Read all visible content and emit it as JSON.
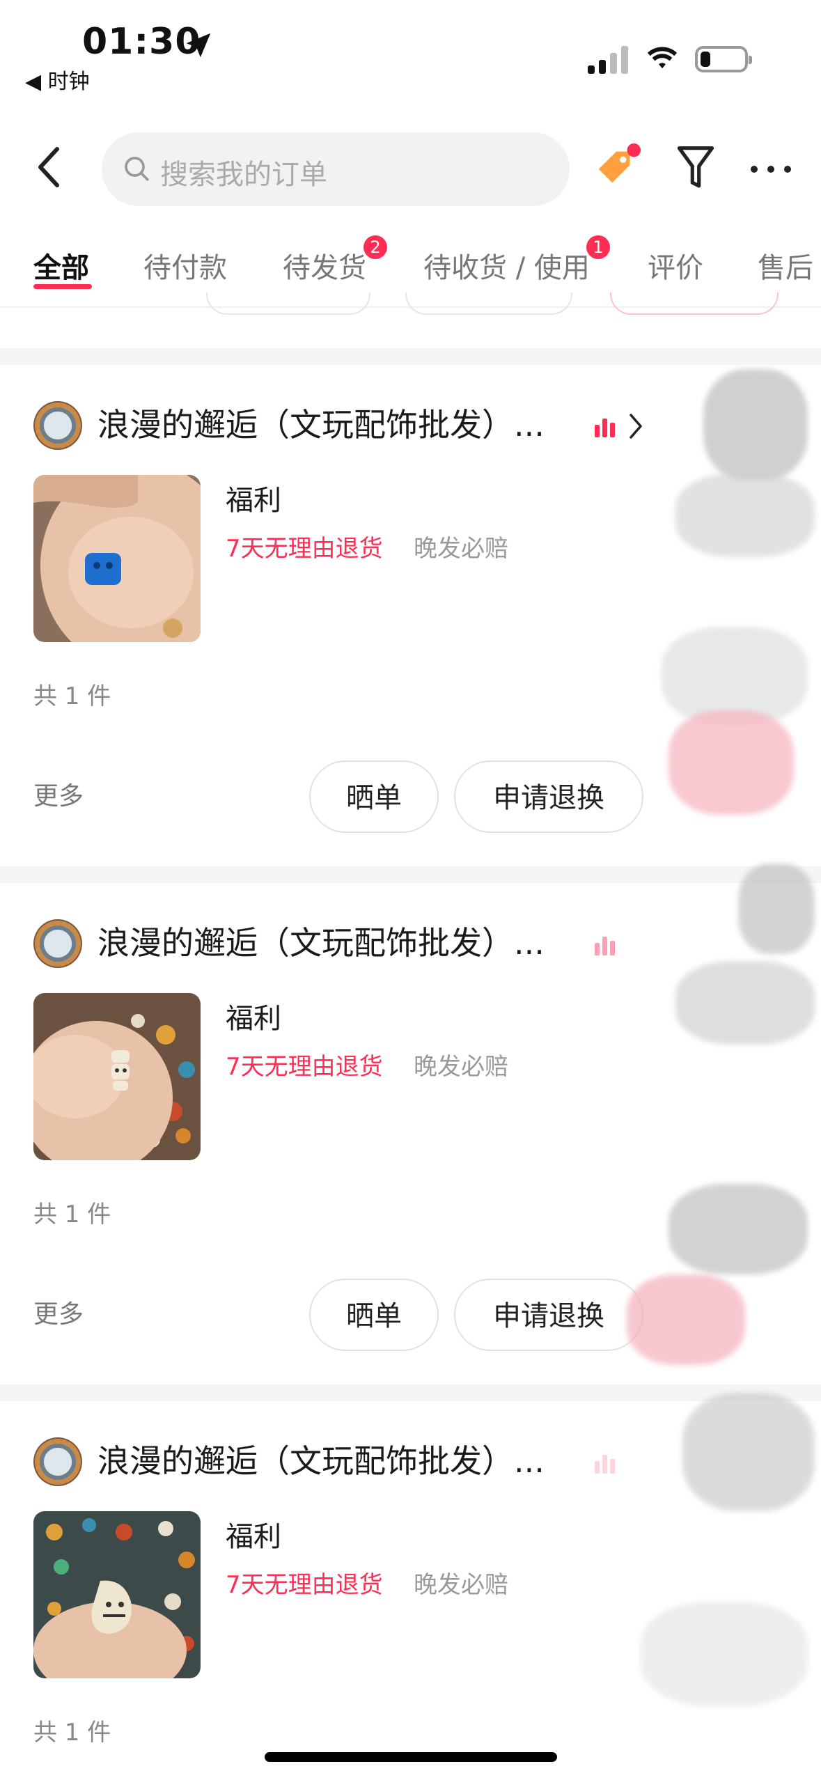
{
  "status_bar": {
    "time": "01:30",
    "back_app": "◀ 时钟"
  },
  "header": {
    "search_placeholder": "搜索我的订单"
  },
  "tabs": [
    {
      "label": "全部",
      "active": true
    },
    {
      "label": "待付款"
    },
    {
      "label": "待发货",
      "badge": "2"
    },
    {
      "label": "待收货 / 使用",
      "badge": "1"
    },
    {
      "label": "评价"
    },
    {
      "label": "售后"
    }
  ],
  "orders": [
    {
      "shop": "浪漫的邂逅（文玩配饰批发）...",
      "title": "福利",
      "tag_return": "7天无理由退货",
      "tag_late": "晚发必赔",
      "qty": "共 1 件",
      "more": "更多",
      "btn_review": "晒单",
      "btn_return": "申请退换"
    },
    {
      "shop": "浪漫的邂逅（文玩配饰批发）...",
      "title": "福利",
      "tag_return": "7天无理由退货",
      "tag_late": "晚发必赔",
      "qty": "共 1 件",
      "more": "更多",
      "btn_review": "晒单",
      "btn_return": "申请退换"
    },
    {
      "shop": "浪漫的邂逅（文玩配饰批发）...",
      "title": "福利",
      "tag_return": "7天无理由退货",
      "tag_late": "晚发必赔",
      "qty": "共 1 件"
    }
  ],
  "colors": {
    "accent": "#ff2d54",
    "tag_icon": "#ff9f3d"
  }
}
